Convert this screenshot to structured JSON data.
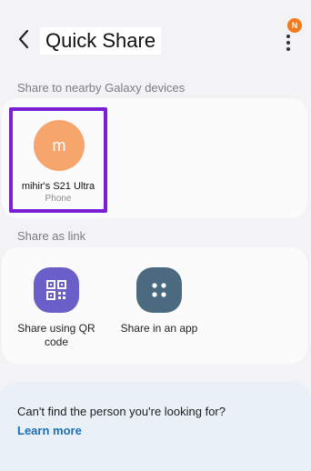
{
  "header": {
    "title": "Quick Share",
    "badge": "N",
    "back_icon": "back-arrow-icon",
    "more_icon": "more-vertical-icon"
  },
  "nearby": {
    "section_label": "Share to nearby Galaxy devices",
    "devices": [
      {
        "initial": "m",
        "name": "mihir's S21 Ultra",
        "type": "Phone"
      }
    ]
  },
  "link": {
    "section_label": "Share as link",
    "options": [
      {
        "label": "Share using QR code",
        "icon": "qr-code-icon"
      },
      {
        "label": "Share in an app",
        "icon": "app-share-icon"
      }
    ]
  },
  "info": {
    "text": "Can't find the person you're looking for?",
    "link": "Learn more"
  },
  "colors": {
    "accent": "#1c6fb6",
    "badge": "#f57a1c",
    "avatar": "#f6a56d",
    "selection_border": "#7a1fd6",
    "qr_icon_bg": "#6a5fc9",
    "app_icon_bg": "#4b6a80"
  }
}
